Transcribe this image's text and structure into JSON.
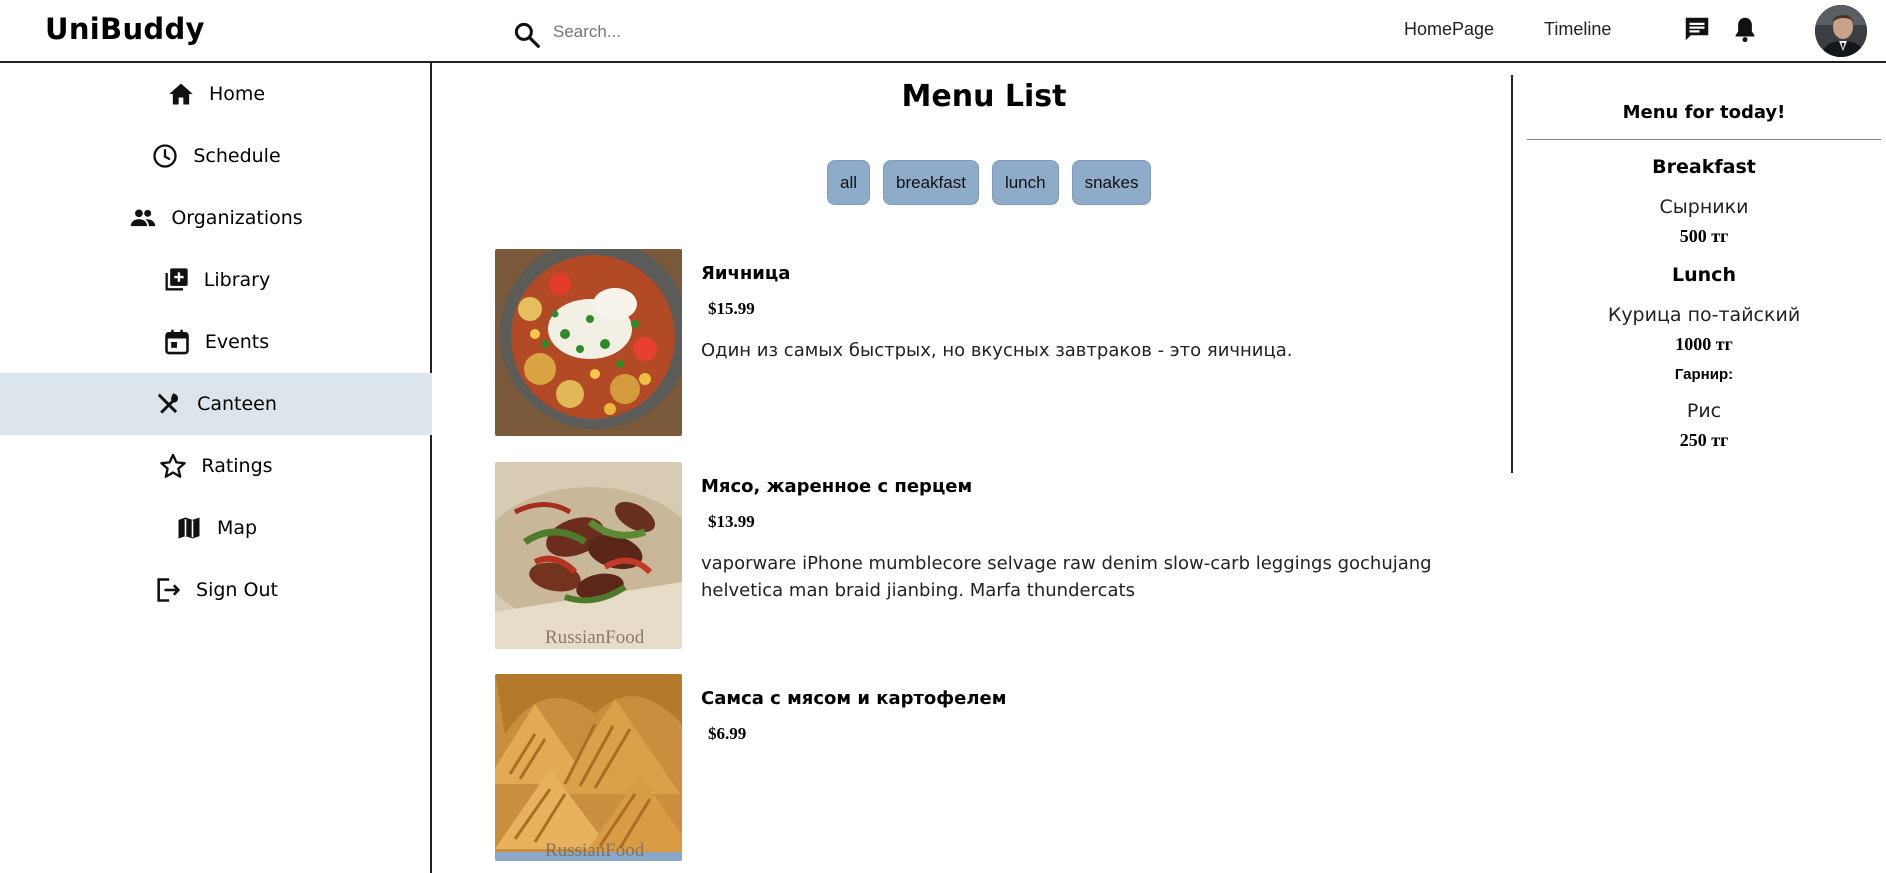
{
  "app": {
    "brand": "UniBuddy"
  },
  "search": {
    "placeholder": "Search..."
  },
  "topnav": {
    "home": "HomePage",
    "timeline": "Timeline"
  },
  "sidebar": {
    "items": [
      {
        "label": "Home",
        "icon": "home-icon"
      },
      {
        "label": "Schedule",
        "icon": "clock-icon"
      },
      {
        "label": "Organizations",
        "icon": "people-icon"
      },
      {
        "label": "Library",
        "icon": "library-add-icon"
      },
      {
        "label": "Events",
        "icon": "calendar-icon"
      },
      {
        "label": "Canteen",
        "icon": "utensils-icon",
        "active": true
      },
      {
        "label": "Ratings",
        "icon": "star-icon"
      },
      {
        "label": "Map",
        "icon": "map-icon"
      },
      {
        "label": "Sign Out",
        "icon": "sign-out-icon"
      }
    ]
  },
  "main": {
    "title": "Menu List",
    "filters": [
      "all",
      "breakfast",
      "lunch",
      "snakes"
    ],
    "items": [
      {
        "name": "Яичница",
        "price": "$15.99",
        "description": "Один из самых быстрых, но вкусных завтраков - это яичница."
      },
      {
        "name": "Мясо, жаренное с перцем",
        "price": "$13.99",
        "description": "vaporware iPhone mumblecore selvage raw denim slow-carb leggings gochujang helvetica man braid jianbing. Marfa thundercats"
      },
      {
        "name": "Самса с мясом и картофелем",
        "price": "$6.99",
        "description": ""
      }
    ],
    "watermark": "RussianFood"
  },
  "today": {
    "title": "Menu for today!",
    "breakfast_label": "Breakfast",
    "breakfast_dish": "Сырники",
    "breakfast_price": "500 тг",
    "lunch_label": "Lunch",
    "lunch_dish": "Курица по-тайский",
    "lunch_price": "1000 тг",
    "garnish_label": "Гарнир:",
    "garnish_dish": "Рис",
    "garnish_price": "250 тг"
  },
  "colors": {
    "filter_bg": "#8eabc9",
    "active_nav_bg": "#dde5ec"
  }
}
